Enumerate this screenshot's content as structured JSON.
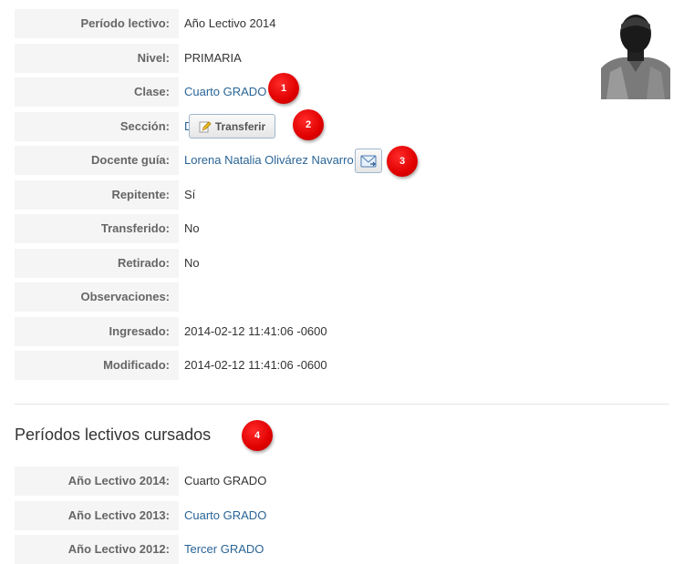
{
  "fields": [
    {
      "label": "Período lectivo:",
      "value": "Año Lectivo 2014",
      "link": false
    },
    {
      "label": "Nivel:",
      "value": "PRIMARIA",
      "link": false
    },
    {
      "label": "Clase:",
      "value": "Cuarto GRADO",
      "link": true
    },
    {
      "label": "Sección:",
      "value": "D",
      "link": true
    },
    {
      "label": "Docente guía:",
      "value": "Lorena Natalia Olivárez Navarro",
      "link": true
    },
    {
      "label": "Repitente:",
      "value": "Sí",
      "link": false
    },
    {
      "label": "Transferido:",
      "value": "No",
      "link": false
    },
    {
      "label": "Retirado:",
      "value": "No",
      "link": false
    },
    {
      "label": "Observaciones:",
      "value": "",
      "link": false
    },
    {
      "label": "Ingresado:",
      "value": "2014-02-12 11:41:06 -0600",
      "link": false
    },
    {
      "label": "Modificado:",
      "value": "2014-02-12 11:41:06 -0600",
      "link": false
    }
  ],
  "transfer_button": {
    "label": "Transferir",
    "icon": "pencil-icon"
  },
  "mail_button": {
    "icon": "envelope-icon"
  },
  "badges": [
    "1",
    "2",
    "3",
    "4"
  ],
  "history": {
    "title": "Períodos lectivos cursados",
    "rows": [
      {
        "label": "Año Lectivo 2014:",
        "value": "Cuarto GRADO",
        "link": false
      },
      {
        "label": "Año Lectivo 2013:",
        "value": "Cuarto GRADO",
        "link": true
      },
      {
        "label": "Año Lectivo 2012:",
        "value": "Tercer GRADO",
        "link": true
      }
    ]
  },
  "colors": {
    "link": "#2a6496",
    "label_bg": "#f5f5f5",
    "badge": "#e00000"
  }
}
